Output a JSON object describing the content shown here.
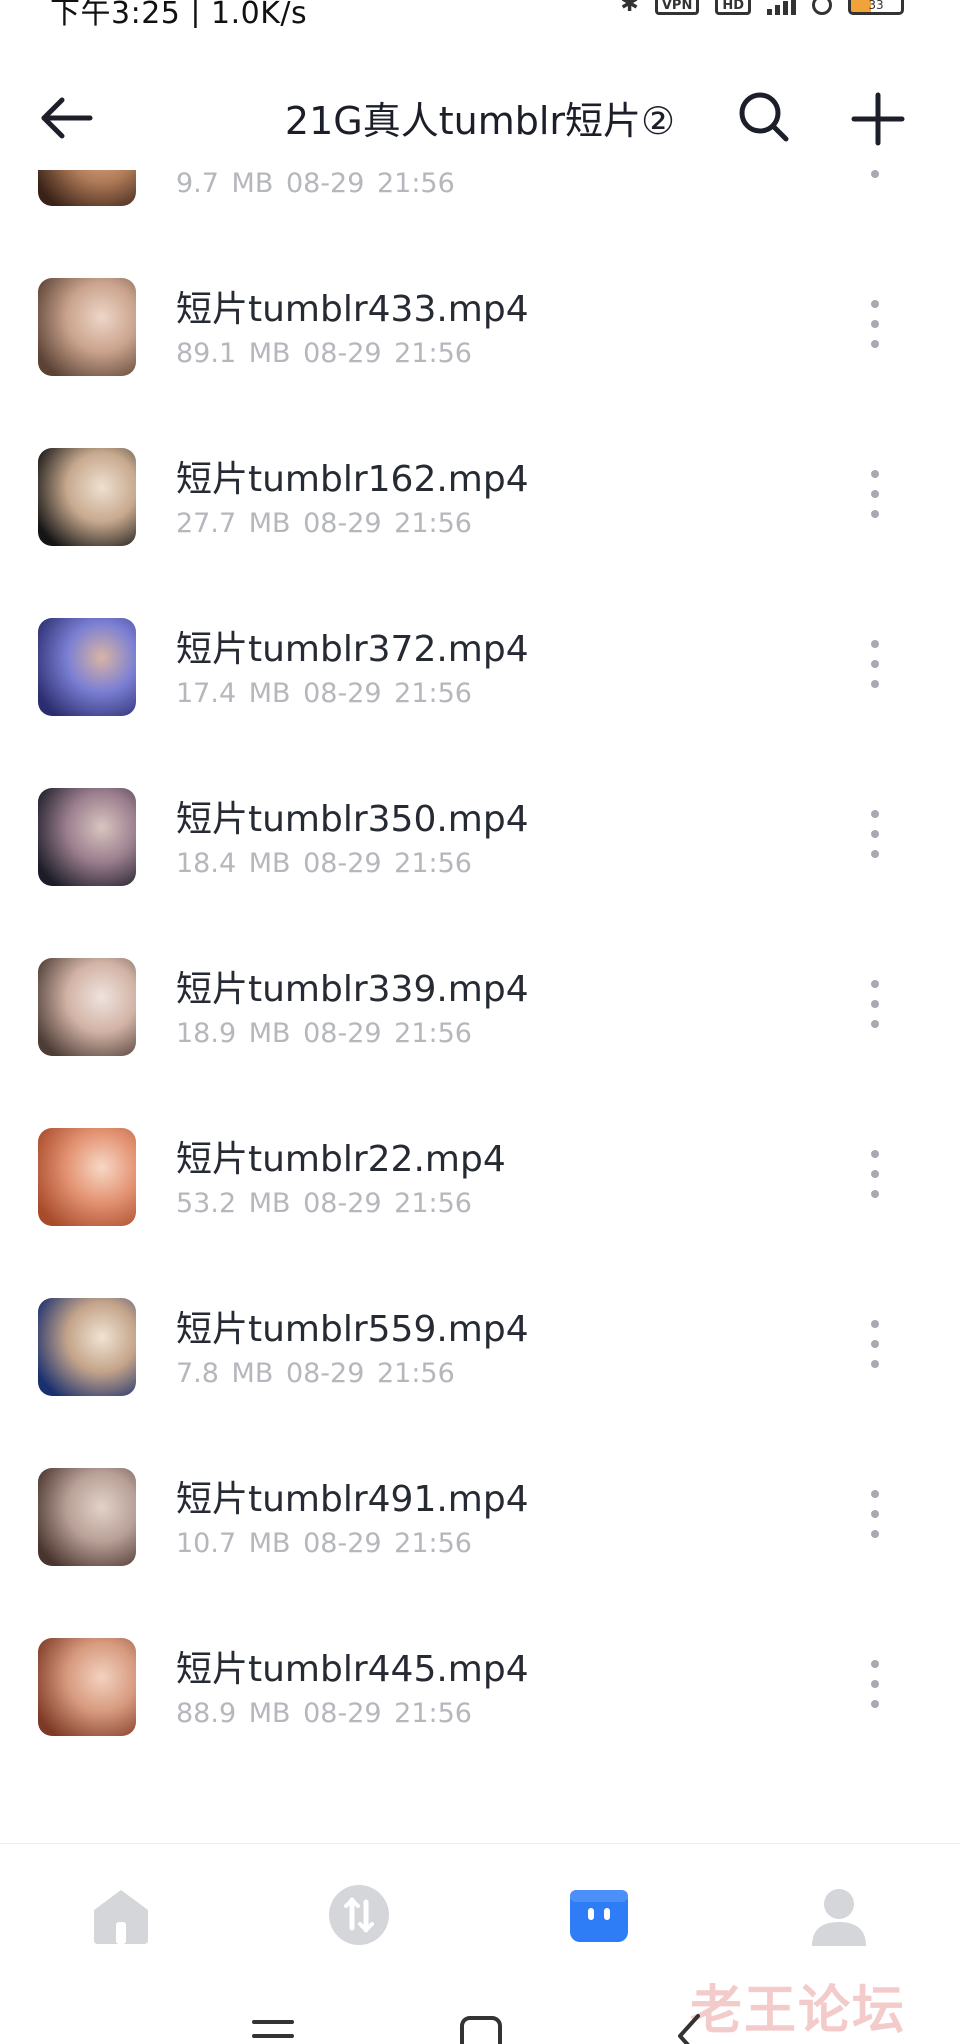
{
  "status_bar": {
    "left_text": "下午3:25 | 1.0K/s",
    "vpn_label": "VPN",
    "hd_label": "HD",
    "battery_level": "33"
  },
  "header": {
    "title": "21G真人tumblr短片②",
    "back_icon": "arrow-left-icon",
    "search_icon": "search-icon",
    "add_icon": "plus-icon"
  },
  "files": [
    {
      "name": "",
      "size": "9.7 MB",
      "date": "08-29 21:56",
      "thumb_colors": [
        "#3a2218",
        "#b07b58",
        "#e2b08e"
      ]
    },
    {
      "name": "短片tumblr433.mp4",
      "size": "89.1 MB",
      "date": "08-29 21:56",
      "thumb_colors": [
        "#5b4235",
        "#caa38d",
        "#eed6c7"
      ]
    },
    {
      "name": "短片tumblr162.mp4",
      "size": "27.7 MB",
      "date": "08-29 21:56",
      "thumb_colors": [
        "#151515",
        "#c7a98e",
        "#efe0d0"
      ]
    },
    {
      "name": "短片tumblr372.mp4",
      "size": "17.4 MB",
      "date": "08-29 21:56",
      "thumb_colors": [
        "#2b2d6e",
        "#7b7fd4",
        "#d8b4a4"
      ]
    },
    {
      "name": "短片tumblr350.mp4",
      "size": "18.4 MB",
      "date": "08-29 21:56",
      "thumb_colors": [
        "#1c1c28",
        "#9c7f8e",
        "#d8c5c0"
      ]
    },
    {
      "name": "短片tumblr339.mp4",
      "size": "18.9 MB",
      "date": "08-29 21:56",
      "thumb_colors": [
        "#4e3d36",
        "#d2b3a6",
        "#efe3dd"
      ]
    },
    {
      "name": "短片tumblr22.mp4",
      "size": "53.2 MB",
      "date": "08-29 21:56",
      "thumb_colors": [
        "#a84b2b",
        "#e49474",
        "#f7d8c6"
      ]
    },
    {
      "name": "短片tumblr559.mp4",
      "size": "7.8 MB",
      "date": "08-29 21:56",
      "thumb_colors": [
        "#1a2f6e",
        "#c4a48a",
        "#f0e3d3"
      ]
    },
    {
      "name": "短片tumblr491.mp4",
      "size": "10.7 MB",
      "date": "08-29 21:56",
      "thumb_colors": [
        "#4a352e",
        "#b8a097",
        "#e2d2c7"
      ]
    },
    {
      "name": "短片tumblr445.mp4",
      "size": "88.9 MB",
      "date": "08-29 21:56",
      "thumb_colors": [
        "#7e3a26",
        "#d79a7f",
        "#f3d2bf"
      ]
    }
  ],
  "bottom_nav": [
    {
      "name": "home",
      "icon": "home-icon",
      "active": false
    },
    {
      "name": "transfer",
      "icon": "transfer-icon",
      "active": false
    },
    {
      "name": "files",
      "icon": "folder-box-icon",
      "active": true
    },
    {
      "name": "profile",
      "icon": "user-icon",
      "active": false
    }
  ],
  "colors": {
    "accent": "#2f7df6",
    "inactive_nav": "#d4d6da",
    "meta_text": "#b5b7bd",
    "watermark": "#f3c2c2"
  },
  "watermark": "老王论坛"
}
